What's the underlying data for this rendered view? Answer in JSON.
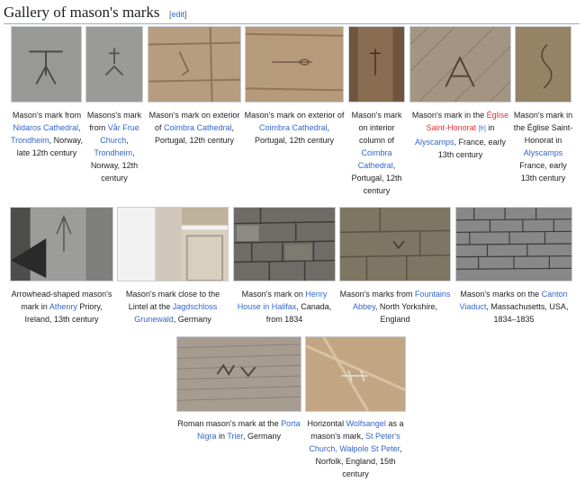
{
  "section": {
    "title": "Gallery of mason's marks",
    "edit_bracket_open": "[",
    "edit_label": "edit",
    "edit_bracket_close": "]"
  },
  "gallery": [
    {
      "caption": [
        {
          "t": "Mason's mark from "
        },
        {
          "t": "Nidaros Cathedral",
          "link": true
        },
        {
          "t": ", "
        },
        {
          "t": "Trondheim",
          "link": true
        },
        {
          "t": ", Norway, late 12th century"
        }
      ]
    },
    {
      "caption": [
        {
          "t": "Masons's mark from "
        },
        {
          "t": "Vår Frue Church",
          "link": true
        },
        {
          "t": ", "
        },
        {
          "t": "Trondheim",
          "link": true
        },
        {
          "t": ", Norway, 12th century"
        }
      ]
    },
    {
      "caption": [
        {
          "t": "Mason's mark on exterior of "
        },
        {
          "t": "Coimbra Cathedral",
          "link": true
        },
        {
          "t": ", Portugal, 12th century"
        }
      ]
    },
    {
      "caption": [
        {
          "t": "Mason's mark on exterior of "
        },
        {
          "t": "Coimbra Cathedral",
          "link": true
        },
        {
          "t": ", Portugal, 12th century"
        }
      ]
    },
    {
      "caption": [
        {
          "t": "Mason's mark on interior column of "
        },
        {
          "t": "Coimbra Cathedral",
          "link": true
        },
        {
          "t": ", Portugal, 12th century"
        }
      ]
    },
    {
      "caption": [
        {
          "t": "Mason's mark in the "
        },
        {
          "t": "Église Saint-Honorat",
          "red": true
        },
        {
          "t": " "
        },
        {
          "t": "[fr]",
          "small": true
        },
        {
          "t": " in "
        },
        {
          "t": "Alyscamps",
          "link": true
        },
        {
          "t": ", France, early 13th century"
        }
      ]
    },
    {
      "caption": [
        {
          "t": "Mason's mark in the Église Saint-Honorat in "
        },
        {
          "t": "Alyscamps",
          "link": true
        },
        {
          "t": " France, early 13th century"
        }
      ]
    },
    {
      "caption": [
        {
          "t": "Arrowhead-shaped mason's mark in "
        },
        {
          "t": "Athenry",
          "link": true
        },
        {
          "t": " Priory, Ireland, 13th century"
        }
      ]
    },
    {
      "caption": [
        {
          "t": "Mason's mark close to the Lintel at the "
        },
        {
          "t": "Jagdschloss Grunewald",
          "link": true
        },
        {
          "t": ", Germany"
        }
      ]
    },
    {
      "caption": [
        {
          "t": "Mason's mark on "
        },
        {
          "t": "Henry House in Halifax",
          "link": true
        },
        {
          "t": ", Canada, from 1834"
        }
      ]
    },
    {
      "caption": [
        {
          "t": "Mason's marks from "
        },
        {
          "t": "Fountains Abbey",
          "link": true
        },
        {
          "t": ", North Yorkshire, England"
        }
      ]
    },
    {
      "caption": [
        {
          "t": "Mason's marks on the "
        },
        {
          "t": "Canton Viaduct",
          "link": true
        },
        {
          "t": ", Massachusetts, USA, 1834–1835"
        }
      ]
    },
    {
      "caption": [
        {
          "t": "Roman mason's mark at the "
        },
        {
          "t": "Porta Nigra",
          "link": true
        },
        {
          "t": " in "
        },
        {
          "t": "Trier",
          "link": true
        },
        {
          "t": ", Germany"
        }
      ]
    },
    {
      "caption": [
        {
          "t": "Horizontal "
        },
        {
          "t": "Wolfsangel",
          "link": true
        },
        {
          "t": " as a mason's mark, "
        },
        {
          "t": "St Peter's Church, Walpole St Peter",
          "link": true
        },
        {
          "t": ", Norfolk, England, 15th century"
        }
      ]
    }
  ],
  "colors": {
    "link": "#3366cc",
    "redlink": "#dd3333",
    "text": "#202122"
  }
}
